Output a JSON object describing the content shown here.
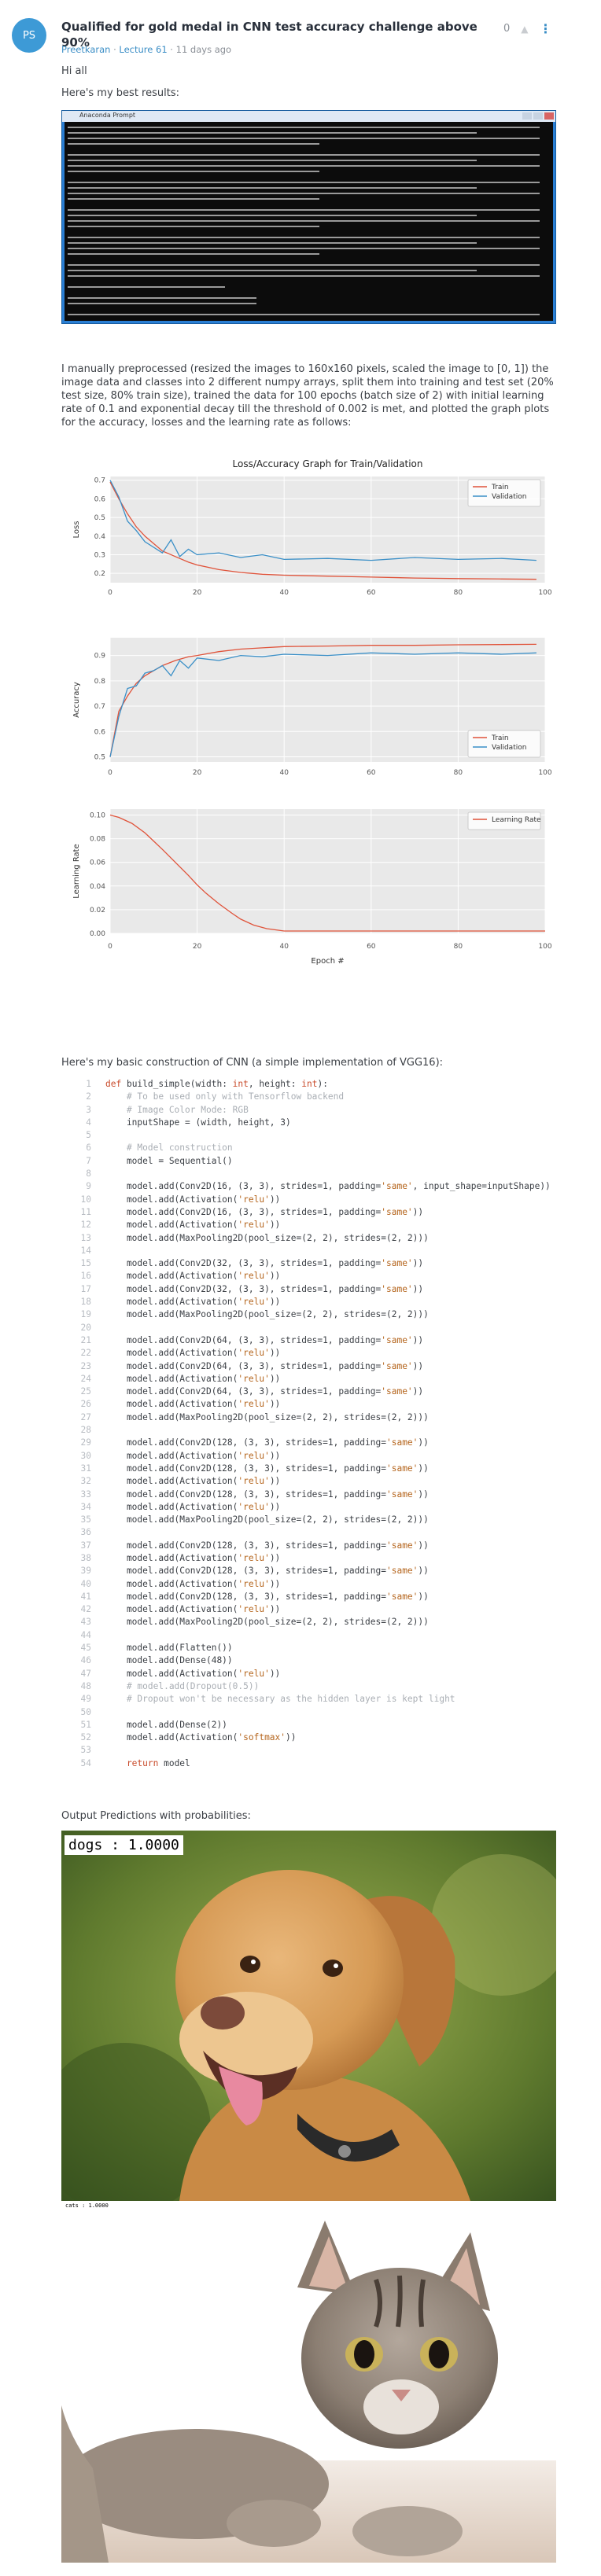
{
  "post": {
    "avatar_initials": "PS",
    "title": "Qualified for gold medal in CNN test accuracy challenge above 90%",
    "author": "Preetkaran",
    "lecture": "Lecture 61",
    "separator": " · ",
    "time": "11 days ago",
    "vote_count": "0",
    "greeting": "Hi all",
    "best_results_intro": "Here's my best results:",
    "console_window_title": "Anaconda Prompt",
    "method_text": "I manually preprocessed (resized the images to 160x160 pixels, scaled the image to [0, 1]) the image data and classes into 2 different numpy arrays, split them into training and test set (20% test size, 80% train size), trained the data for 100 epochs (batch size of 2) with initial learning rate of 0.1 and exponential decay till the threshold of 0.002 is met, and plotted the graph plots for the accuracy, losses and the learning rate as follows:",
    "cnn_intro": "Here's my basic construction of CNN (a simple implementation of VGG16):",
    "predictions_intro": "Output Predictions with probabilities:",
    "dog_label": "dogs : 1.0000",
    "cat_label": "cats : 1.0000"
  },
  "chart_data": [
    {
      "type": "line",
      "title": "Loss/Accuracy Graph for Train/Validation",
      "ylabel": "Loss",
      "xlabel": "",
      "xlim": [
        0,
        100
      ],
      "ylim": [
        0.15,
        0.72
      ],
      "x_ticks": [
        "0",
        "20",
        "40",
        "60",
        "80",
        "100"
      ],
      "y_ticks": [
        "0.2",
        "0.3",
        "0.4",
        "0.5",
        "0.6",
        "0.7"
      ],
      "legend": "top-right",
      "grid": true,
      "series": [
        {
          "name": "Train",
          "color": "#e0533a",
          "x": [
            0,
            2,
            4,
            6,
            8,
            10,
            12,
            15,
            18,
            20,
            25,
            30,
            35,
            40,
            50,
            60,
            70,
            80,
            90,
            98
          ],
          "y": [
            0.69,
            0.6,
            0.52,
            0.45,
            0.4,
            0.36,
            0.32,
            0.29,
            0.26,
            0.245,
            0.22,
            0.205,
            0.195,
            0.19,
            0.185,
            0.18,
            0.175,
            0.172,
            0.17,
            0.168
          ]
        },
        {
          "name": "Validation",
          "color": "#3a8fc7",
          "x": [
            0,
            2,
            4,
            6,
            8,
            10,
            12,
            14,
            16,
            18,
            20,
            25,
            30,
            35,
            40,
            50,
            60,
            70,
            80,
            90,
            98
          ],
          "y": [
            0.7,
            0.61,
            0.48,
            0.43,
            0.37,
            0.34,
            0.31,
            0.38,
            0.29,
            0.33,
            0.3,
            0.31,
            0.285,
            0.3,
            0.275,
            0.28,
            0.27,
            0.285,
            0.275,
            0.28,
            0.27
          ]
        }
      ]
    },
    {
      "type": "line",
      "ylabel": "Accuracy",
      "xlabel": "",
      "xlim": [
        0,
        100
      ],
      "ylim": [
        0.48,
        0.97
      ],
      "x_ticks": [
        "0",
        "20",
        "40",
        "60",
        "80",
        "100"
      ],
      "y_ticks": [
        "0.5",
        "0.6",
        "0.7",
        "0.8",
        "0.9"
      ],
      "legend": "bottom-right",
      "grid": true,
      "series": [
        {
          "name": "Train",
          "color": "#e0533a",
          "x": [
            0,
            2,
            4,
            6,
            8,
            10,
            12,
            15,
            18,
            20,
            25,
            30,
            35,
            40,
            50,
            60,
            70,
            80,
            90,
            98
          ],
          "y": [
            0.5,
            0.68,
            0.74,
            0.79,
            0.82,
            0.84,
            0.86,
            0.88,
            0.895,
            0.9,
            0.915,
            0.925,
            0.93,
            0.935,
            0.937,
            0.94,
            0.94,
            0.942,
            0.943,
            0.944
          ]
        },
        {
          "name": "Validation",
          "color": "#3a8fc7",
          "x": [
            0,
            2,
            4,
            6,
            8,
            10,
            12,
            14,
            16,
            18,
            20,
            25,
            30,
            35,
            40,
            50,
            60,
            70,
            80,
            90,
            98
          ],
          "y": [
            0.5,
            0.66,
            0.77,
            0.78,
            0.83,
            0.84,
            0.86,
            0.82,
            0.88,
            0.85,
            0.89,
            0.88,
            0.9,
            0.895,
            0.905,
            0.9,
            0.91,
            0.905,
            0.91,
            0.905,
            0.91
          ]
        }
      ]
    },
    {
      "type": "line",
      "ylabel": "Learning Rate",
      "xlabel": "Epoch #",
      "xlim": [
        0,
        100
      ],
      "ylim": [
        0,
        0.105
      ],
      "x_ticks": [
        "0",
        "20",
        "40",
        "60",
        "80",
        "100"
      ],
      "y_ticks": [
        "0.00",
        "0.02",
        "0.04",
        "0.06",
        "0.08",
        "0.10"
      ],
      "legend": "top-right",
      "grid": true,
      "series": [
        {
          "name": "Learning Rate",
          "color": "#e0533a",
          "x": [
            0,
            2,
            5,
            8,
            10,
            12,
            15,
            18,
            20,
            22,
            25,
            28,
            30,
            33,
            36,
            40,
            45,
            50,
            60,
            70,
            80,
            90,
            100
          ],
          "y": [
            0.1,
            0.098,
            0.093,
            0.085,
            0.078,
            0.071,
            0.06,
            0.049,
            0.041,
            0.034,
            0.025,
            0.017,
            0.012,
            0.007,
            0.004,
            0.002,
            0.002,
            0.002,
            0.002,
            0.002,
            0.002,
            0.002,
            0.002
          ]
        }
      ]
    }
  ],
  "code_lines": [
    {
      "n": "1",
      "parts": [
        [
          "kw",
          "def "
        ],
        [
          "",
          "build_simple(width: "
        ],
        [
          "kw",
          "int"
        ],
        [
          "",
          ", height: "
        ],
        [
          "kw",
          "int"
        ],
        [
          "",
          "):"
        ]
      ]
    },
    {
      "n": "2",
      "parts": [
        [
          "cm",
          "    # To be used only with Tensorflow backend"
        ]
      ]
    },
    {
      "n": "3",
      "parts": [
        [
          "cm",
          "    # Image Color Mode: RGB"
        ]
      ]
    },
    {
      "n": "4",
      "parts": [
        [
          "",
          "    inputShape = (width, height, 3)"
        ]
      ]
    },
    {
      "n": "5",
      "parts": [
        [
          "",
          ""
        ]
      ]
    },
    {
      "n": "6",
      "parts": [
        [
          "cm",
          "    # Model construction"
        ]
      ]
    },
    {
      "n": "7",
      "parts": [
        [
          "",
          "    model = Sequential()"
        ]
      ]
    },
    {
      "n": "8",
      "parts": [
        [
          "",
          ""
        ]
      ]
    },
    {
      "n": "9",
      "parts": [
        [
          "",
          "    model.add(Conv2D(16, (3, 3), strides=1, padding="
        ],
        [
          "str",
          "'same'"
        ],
        [
          "",
          ", input_shape=inputShape))"
        ]
      ]
    },
    {
      "n": "10",
      "parts": [
        [
          "",
          "    model.add(Activation("
        ],
        [
          "str",
          "'relu'"
        ],
        [
          "",
          "))"
        ]
      ]
    },
    {
      "n": "11",
      "parts": [
        [
          "",
          "    model.add(Conv2D(16, (3, 3), strides=1, padding="
        ],
        [
          "str",
          "'same'"
        ],
        [
          "",
          "))"
        ]
      ]
    },
    {
      "n": "12",
      "parts": [
        [
          "",
          "    model.add(Activation("
        ],
        [
          "str",
          "'relu'"
        ],
        [
          "",
          "))"
        ]
      ]
    },
    {
      "n": "13",
      "parts": [
        [
          "",
          "    model.add(MaxPooling2D(pool_size=(2, 2), strides=(2, 2)))"
        ]
      ]
    },
    {
      "n": "14",
      "parts": [
        [
          "",
          ""
        ]
      ]
    },
    {
      "n": "15",
      "parts": [
        [
          "",
          "    model.add(Conv2D(32, (3, 3), strides=1, padding="
        ],
        [
          "str",
          "'same'"
        ],
        [
          "",
          "))"
        ]
      ]
    },
    {
      "n": "16",
      "parts": [
        [
          "",
          "    model.add(Activation("
        ],
        [
          "str",
          "'relu'"
        ],
        [
          "",
          "))"
        ]
      ]
    },
    {
      "n": "17",
      "parts": [
        [
          "",
          "    model.add(Conv2D(32, (3, 3), strides=1, padding="
        ],
        [
          "str",
          "'same'"
        ],
        [
          "",
          "))"
        ]
      ]
    },
    {
      "n": "18",
      "parts": [
        [
          "",
          "    model.add(Activation("
        ],
        [
          "str",
          "'relu'"
        ],
        [
          "",
          "))"
        ]
      ]
    },
    {
      "n": "19",
      "parts": [
        [
          "",
          "    model.add(MaxPooling2D(pool_size=(2, 2), strides=(2, 2)))"
        ]
      ]
    },
    {
      "n": "20",
      "parts": [
        [
          "",
          ""
        ]
      ]
    },
    {
      "n": "21",
      "parts": [
        [
          "",
          "    model.add(Conv2D(64, (3, 3), strides=1, padding="
        ],
        [
          "str",
          "'same'"
        ],
        [
          "",
          "))"
        ]
      ]
    },
    {
      "n": "22",
      "parts": [
        [
          "",
          "    model.add(Activation("
        ],
        [
          "str",
          "'relu'"
        ],
        [
          "",
          "))"
        ]
      ]
    },
    {
      "n": "23",
      "parts": [
        [
          "",
          "    model.add(Conv2D(64, (3, 3), strides=1, padding="
        ],
        [
          "str",
          "'same'"
        ],
        [
          "",
          "))"
        ]
      ]
    },
    {
      "n": "24",
      "parts": [
        [
          "",
          "    model.add(Activation("
        ],
        [
          "str",
          "'relu'"
        ],
        [
          "",
          "))"
        ]
      ]
    },
    {
      "n": "25",
      "parts": [
        [
          "",
          "    model.add(Conv2D(64, (3, 3), strides=1, padding="
        ],
        [
          "str",
          "'same'"
        ],
        [
          "",
          "))"
        ]
      ]
    },
    {
      "n": "26",
      "parts": [
        [
          "",
          "    model.add(Activation("
        ],
        [
          "str",
          "'relu'"
        ],
        [
          "",
          "))"
        ]
      ]
    },
    {
      "n": "27",
      "parts": [
        [
          "",
          "    model.add(MaxPooling2D(pool_size=(2, 2), strides=(2, 2)))"
        ]
      ]
    },
    {
      "n": "28",
      "parts": [
        [
          "",
          ""
        ]
      ]
    },
    {
      "n": "29",
      "parts": [
        [
          "",
          "    model.add(Conv2D(128, (3, 3), strides=1, padding="
        ],
        [
          "str",
          "'same'"
        ],
        [
          "",
          "))"
        ]
      ]
    },
    {
      "n": "30",
      "parts": [
        [
          "",
          "    model.add(Activation("
        ],
        [
          "str",
          "'relu'"
        ],
        [
          "",
          "))"
        ]
      ]
    },
    {
      "n": "31",
      "parts": [
        [
          "",
          "    model.add(Conv2D(128, (3, 3), strides=1, padding="
        ],
        [
          "str",
          "'same'"
        ],
        [
          "",
          "))"
        ]
      ]
    },
    {
      "n": "32",
      "parts": [
        [
          "",
          "    model.add(Activation("
        ],
        [
          "str",
          "'relu'"
        ],
        [
          "",
          "))"
        ]
      ]
    },
    {
      "n": "33",
      "parts": [
        [
          "",
          "    model.add(Conv2D(128, (3, 3), strides=1, padding="
        ],
        [
          "str",
          "'same'"
        ],
        [
          "",
          "))"
        ]
      ]
    },
    {
      "n": "34",
      "parts": [
        [
          "",
          "    model.add(Activation("
        ],
        [
          "str",
          "'relu'"
        ],
        [
          "",
          "))"
        ]
      ]
    },
    {
      "n": "35",
      "parts": [
        [
          "",
          "    model.add(MaxPooling2D(pool_size=(2, 2), strides=(2, 2)))"
        ]
      ]
    },
    {
      "n": "36",
      "parts": [
        [
          "",
          ""
        ]
      ]
    },
    {
      "n": "37",
      "parts": [
        [
          "",
          "    model.add(Conv2D(128, (3, 3), strides=1, padding="
        ],
        [
          "str",
          "'same'"
        ],
        [
          "",
          "))"
        ]
      ]
    },
    {
      "n": "38",
      "parts": [
        [
          "",
          "    model.add(Activation("
        ],
        [
          "str",
          "'relu'"
        ],
        [
          "",
          "))"
        ]
      ]
    },
    {
      "n": "39",
      "parts": [
        [
          "",
          "    model.add(Conv2D(128, (3, 3), strides=1, padding="
        ],
        [
          "str",
          "'same'"
        ],
        [
          "",
          "))"
        ]
      ]
    },
    {
      "n": "40",
      "parts": [
        [
          "",
          "    model.add(Activation("
        ],
        [
          "str",
          "'relu'"
        ],
        [
          "",
          "))"
        ]
      ]
    },
    {
      "n": "41",
      "parts": [
        [
          "",
          "    model.add(Conv2D(128, (3, 3), strides=1, padding="
        ],
        [
          "str",
          "'same'"
        ],
        [
          "",
          "))"
        ]
      ]
    },
    {
      "n": "42",
      "parts": [
        [
          "",
          "    model.add(Activation("
        ],
        [
          "str",
          "'relu'"
        ],
        [
          "",
          "))"
        ]
      ]
    },
    {
      "n": "43",
      "parts": [
        [
          "",
          "    model.add(MaxPooling2D(pool_size=(2, 2), strides=(2, 2)))"
        ]
      ]
    },
    {
      "n": "44",
      "parts": [
        [
          "",
          ""
        ]
      ]
    },
    {
      "n": "45",
      "parts": [
        [
          "",
          "    model.add(Flatten())"
        ]
      ]
    },
    {
      "n": "46",
      "parts": [
        [
          "",
          "    model.add(Dense(48))"
        ]
      ]
    },
    {
      "n": "47",
      "parts": [
        [
          "",
          "    model.add(Activation("
        ],
        [
          "str",
          "'relu'"
        ],
        [
          "",
          "))"
        ]
      ]
    },
    {
      "n": "48",
      "parts": [
        [
          "cm",
          "    # model.add(Dropout(0.5))"
        ]
      ]
    },
    {
      "n": "49",
      "parts": [
        [
          "cm",
          "    # Dropout won't be necessary as the hidden layer is kept light"
        ]
      ]
    },
    {
      "n": "50",
      "parts": [
        [
          "",
          ""
        ]
      ]
    },
    {
      "n": "51",
      "parts": [
        [
          "",
          "    model.add(Dense(2))"
        ]
      ]
    },
    {
      "n": "52",
      "parts": [
        [
          "",
          "    model.add(Activation("
        ],
        [
          "str",
          "'softmax'"
        ],
        [
          "",
          "))"
        ]
      ]
    },
    {
      "n": "53",
      "parts": [
        [
          "",
          ""
        ]
      ]
    },
    {
      "n": "54",
      "parts": [
        [
          "kw",
          "    return "
        ],
        [
          "",
          "model"
        ]
      ]
    }
  ],
  "colors": {
    "accent_link": "#3b8ec6",
    "avatar_bg": "#3d9ad6",
    "train_line": "#e0533a",
    "validation_line": "#3a8fc7",
    "chart_bg": "#e9e9e9"
  }
}
